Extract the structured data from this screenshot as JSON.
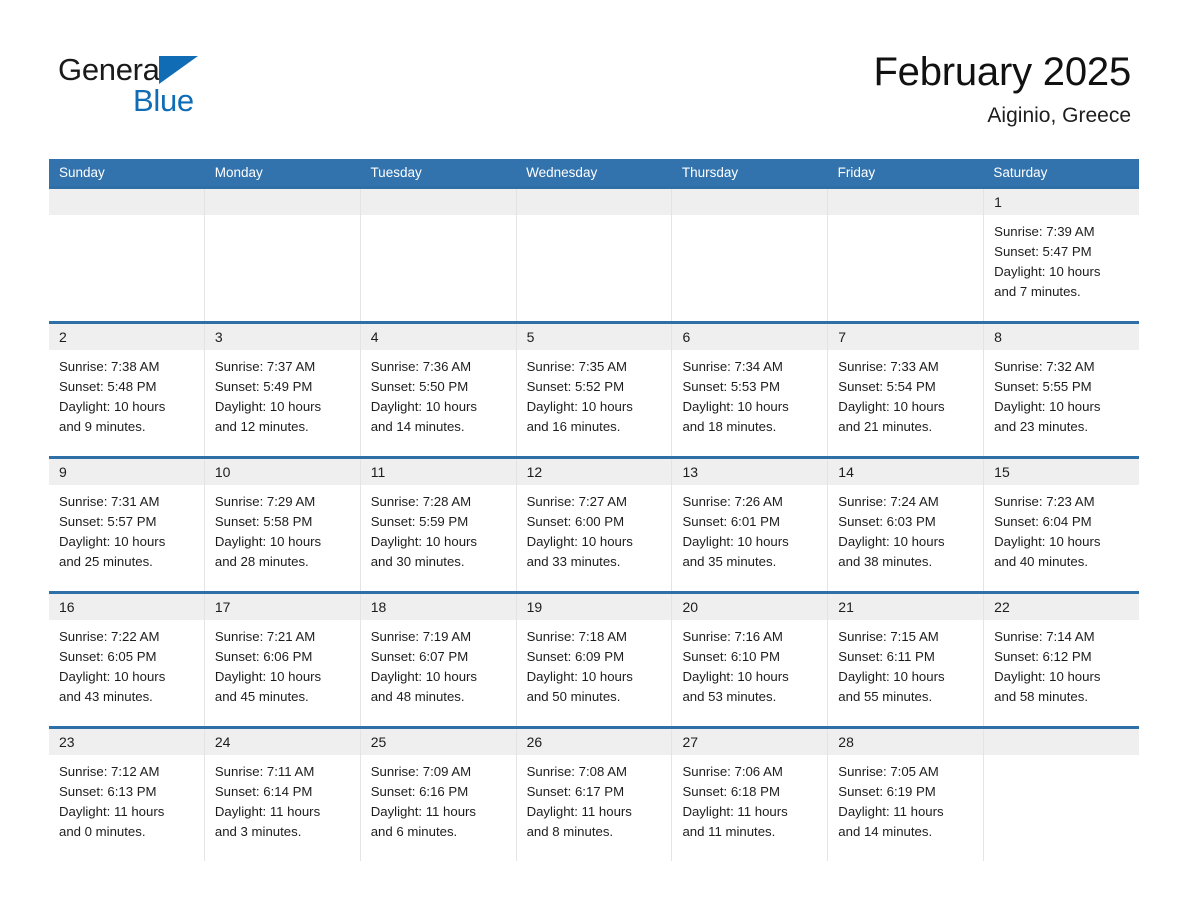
{
  "logo": {
    "word_one": "General",
    "word_two": "Blue",
    "triangle_icon": "triangle-icon",
    "brand_color": "#0f6cb5"
  },
  "header": {
    "title": "February 2025",
    "subtitle": "Aiginio, Greece"
  },
  "theme": {
    "header_row_bg": "#3273ae",
    "week_divider": "#2f6fa8",
    "day_number_strip_bg": "#efefef",
    "text": "#1d1d1d"
  },
  "weekdays": [
    "Sunday",
    "Monday",
    "Tuesday",
    "Wednesday",
    "Thursday",
    "Friday",
    "Saturday"
  ],
  "weeks": [
    [
      {
        "day": "",
        "sunrise": "",
        "sunset": "",
        "daylight_line1": "",
        "daylight_line2": ""
      },
      {
        "day": "",
        "sunrise": "",
        "sunset": "",
        "daylight_line1": "",
        "daylight_line2": ""
      },
      {
        "day": "",
        "sunrise": "",
        "sunset": "",
        "daylight_line1": "",
        "daylight_line2": ""
      },
      {
        "day": "",
        "sunrise": "",
        "sunset": "",
        "daylight_line1": "",
        "daylight_line2": ""
      },
      {
        "day": "",
        "sunrise": "",
        "sunset": "",
        "daylight_line1": "",
        "daylight_line2": ""
      },
      {
        "day": "",
        "sunrise": "",
        "sunset": "",
        "daylight_line1": "",
        "daylight_line2": ""
      },
      {
        "day": "1",
        "sunrise": "Sunrise: 7:39 AM",
        "sunset": "Sunset: 5:47 PM",
        "daylight_line1": "Daylight: 10 hours",
        "daylight_line2": "and 7 minutes."
      }
    ],
    [
      {
        "day": "2",
        "sunrise": "Sunrise: 7:38 AM",
        "sunset": "Sunset: 5:48 PM",
        "daylight_line1": "Daylight: 10 hours",
        "daylight_line2": "and 9 minutes."
      },
      {
        "day": "3",
        "sunrise": "Sunrise: 7:37 AM",
        "sunset": "Sunset: 5:49 PM",
        "daylight_line1": "Daylight: 10 hours",
        "daylight_line2": "and 12 minutes."
      },
      {
        "day": "4",
        "sunrise": "Sunrise: 7:36 AM",
        "sunset": "Sunset: 5:50 PM",
        "daylight_line1": "Daylight: 10 hours",
        "daylight_line2": "and 14 minutes."
      },
      {
        "day": "5",
        "sunrise": "Sunrise: 7:35 AM",
        "sunset": "Sunset: 5:52 PM",
        "daylight_line1": "Daylight: 10 hours",
        "daylight_line2": "and 16 minutes."
      },
      {
        "day": "6",
        "sunrise": "Sunrise: 7:34 AM",
        "sunset": "Sunset: 5:53 PM",
        "daylight_line1": "Daylight: 10 hours",
        "daylight_line2": "and 18 minutes."
      },
      {
        "day": "7",
        "sunrise": "Sunrise: 7:33 AM",
        "sunset": "Sunset: 5:54 PM",
        "daylight_line1": "Daylight: 10 hours",
        "daylight_line2": "and 21 minutes."
      },
      {
        "day": "8",
        "sunrise": "Sunrise: 7:32 AM",
        "sunset": "Sunset: 5:55 PM",
        "daylight_line1": "Daylight: 10 hours",
        "daylight_line2": "and 23 minutes."
      }
    ],
    [
      {
        "day": "9",
        "sunrise": "Sunrise: 7:31 AM",
        "sunset": "Sunset: 5:57 PM",
        "daylight_line1": "Daylight: 10 hours",
        "daylight_line2": "and 25 minutes."
      },
      {
        "day": "10",
        "sunrise": "Sunrise: 7:29 AM",
        "sunset": "Sunset: 5:58 PM",
        "daylight_line1": "Daylight: 10 hours",
        "daylight_line2": "and 28 minutes."
      },
      {
        "day": "11",
        "sunrise": "Sunrise: 7:28 AM",
        "sunset": "Sunset: 5:59 PM",
        "daylight_line1": "Daylight: 10 hours",
        "daylight_line2": "and 30 minutes."
      },
      {
        "day": "12",
        "sunrise": "Sunrise: 7:27 AM",
        "sunset": "Sunset: 6:00 PM",
        "daylight_line1": "Daylight: 10 hours",
        "daylight_line2": "and 33 minutes."
      },
      {
        "day": "13",
        "sunrise": "Sunrise: 7:26 AM",
        "sunset": "Sunset: 6:01 PM",
        "daylight_line1": "Daylight: 10 hours",
        "daylight_line2": "and 35 minutes."
      },
      {
        "day": "14",
        "sunrise": "Sunrise: 7:24 AM",
        "sunset": "Sunset: 6:03 PM",
        "daylight_line1": "Daylight: 10 hours",
        "daylight_line2": "and 38 minutes."
      },
      {
        "day": "15",
        "sunrise": "Sunrise: 7:23 AM",
        "sunset": "Sunset: 6:04 PM",
        "daylight_line1": "Daylight: 10 hours",
        "daylight_line2": "and 40 minutes."
      }
    ],
    [
      {
        "day": "16",
        "sunrise": "Sunrise: 7:22 AM",
        "sunset": "Sunset: 6:05 PM",
        "daylight_line1": "Daylight: 10 hours",
        "daylight_line2": "and 43 minutes."
      },
      {
        "day": "17",
        "sunrise": "Sunrise: 7:21 AM",
        "sunset": "Sunset: 6:06 PM",
        "daylight_line1": "Daylight: 10 hours",
        "daylight_line2": "and 45 minutes."
      },
      {
        "day": "18",
        "sunrise": "Sunrise: 7:19 AM",
        "sunset": "Sunset: 6:07 PM",
        "daylight_line1": "Daylight: 10 hours",
        "daylight_line2": "and 48 minutes."
      },
      {
        "day": "19",
        "sunrise": "Sunrise: 7:18 AM",
        "sunset": "Sunset: 6:09 PM",
        "daylight_line1": "Daylight: 10 hours",
        "daylight_line2": "and 50 minutes."
      },
      {
        "day": "20",
        "sunrise": "Sunrise: 7:16 AM",
        "sunset": "Sunset: 6:10 PM",
        "daylight_line1": "Daylight: 10 hours",
        "daylight_line2": "and 53 minutes."
      },
      {
        "day": "21",
        "sunrise": "Sunrise: 7:15 AM",
        "sunset": "Sunset: 6:11 PM",
        "daylight_line1": "Daylight: 10 hours",
        "daylight_line2": "and 55 minutes."
      },
      {
        "day": "22",
        "sunrise": "Sunrise: 7:14 AM",
        "sunset": "Sunset: 6:12 PM",
        "daylight_line1": "Daylight: 10 hours",
        "daylight_line2": "and 58 minutes."
      }
    ],
    [
      {
        "day": "23",
        "sunrise": "Sunrise: 7:12 AM",
        "sunset": "Sunset: 6:13 PM",
        "daylight_line1": "Daylight: 11 hours",
        "daylight_line2": "and 0 minutes."
      },
      {
        "day": "24",
        "sunrise": "Sunrise: 7:11 AM",
        "sunset": "Sunset: 6:14 PM",
        "daylight_line1": "Daylight: 11 hours",
        "daylight_line2": "and 3 minutes."
      },
      {
        "day": "25",
        "sunrise": "Sunrise: 7:09 AM",
        "sunset": "Sunset: 6:16 PM",
        "daylight_line1": "Daylight: 11 hours",
        "daylight_line2": "and 6 minutes."
      },
      {
        "day": "26",
        "sunrise": "Sunrise: 7:08 AM",
        "sunset": "Sunset: 6:17 PM",
        "daylight_line1": "Daylight: 11 hours",
        "daylight_line2": "and 8 minutes."
      },
      {
        "day": "27",
        "sunrise": "Sunrise: 7:06 AM",
        "sunset": "Sunset: 6:18 PM",
        "daylight_line1": "Daylight: 11 hours",
        "daylight_line2": "and 11 minutes."
      },
      {
        "day": "28",
        "sunrise": "Sunrise: 7:05 AM",
        "sunset": "Sunset: 6:19 PM",
        "daylight_line1": "Daylight: 11 hours",
        "daylight_line2": "and 14 minutes."
      },
      {
        "day": "",
        "sunrise": "",
        "sunset": "",
        "daylight_line1": "",
        "daylight_line2": ""
      }
    ]
  ]
}
